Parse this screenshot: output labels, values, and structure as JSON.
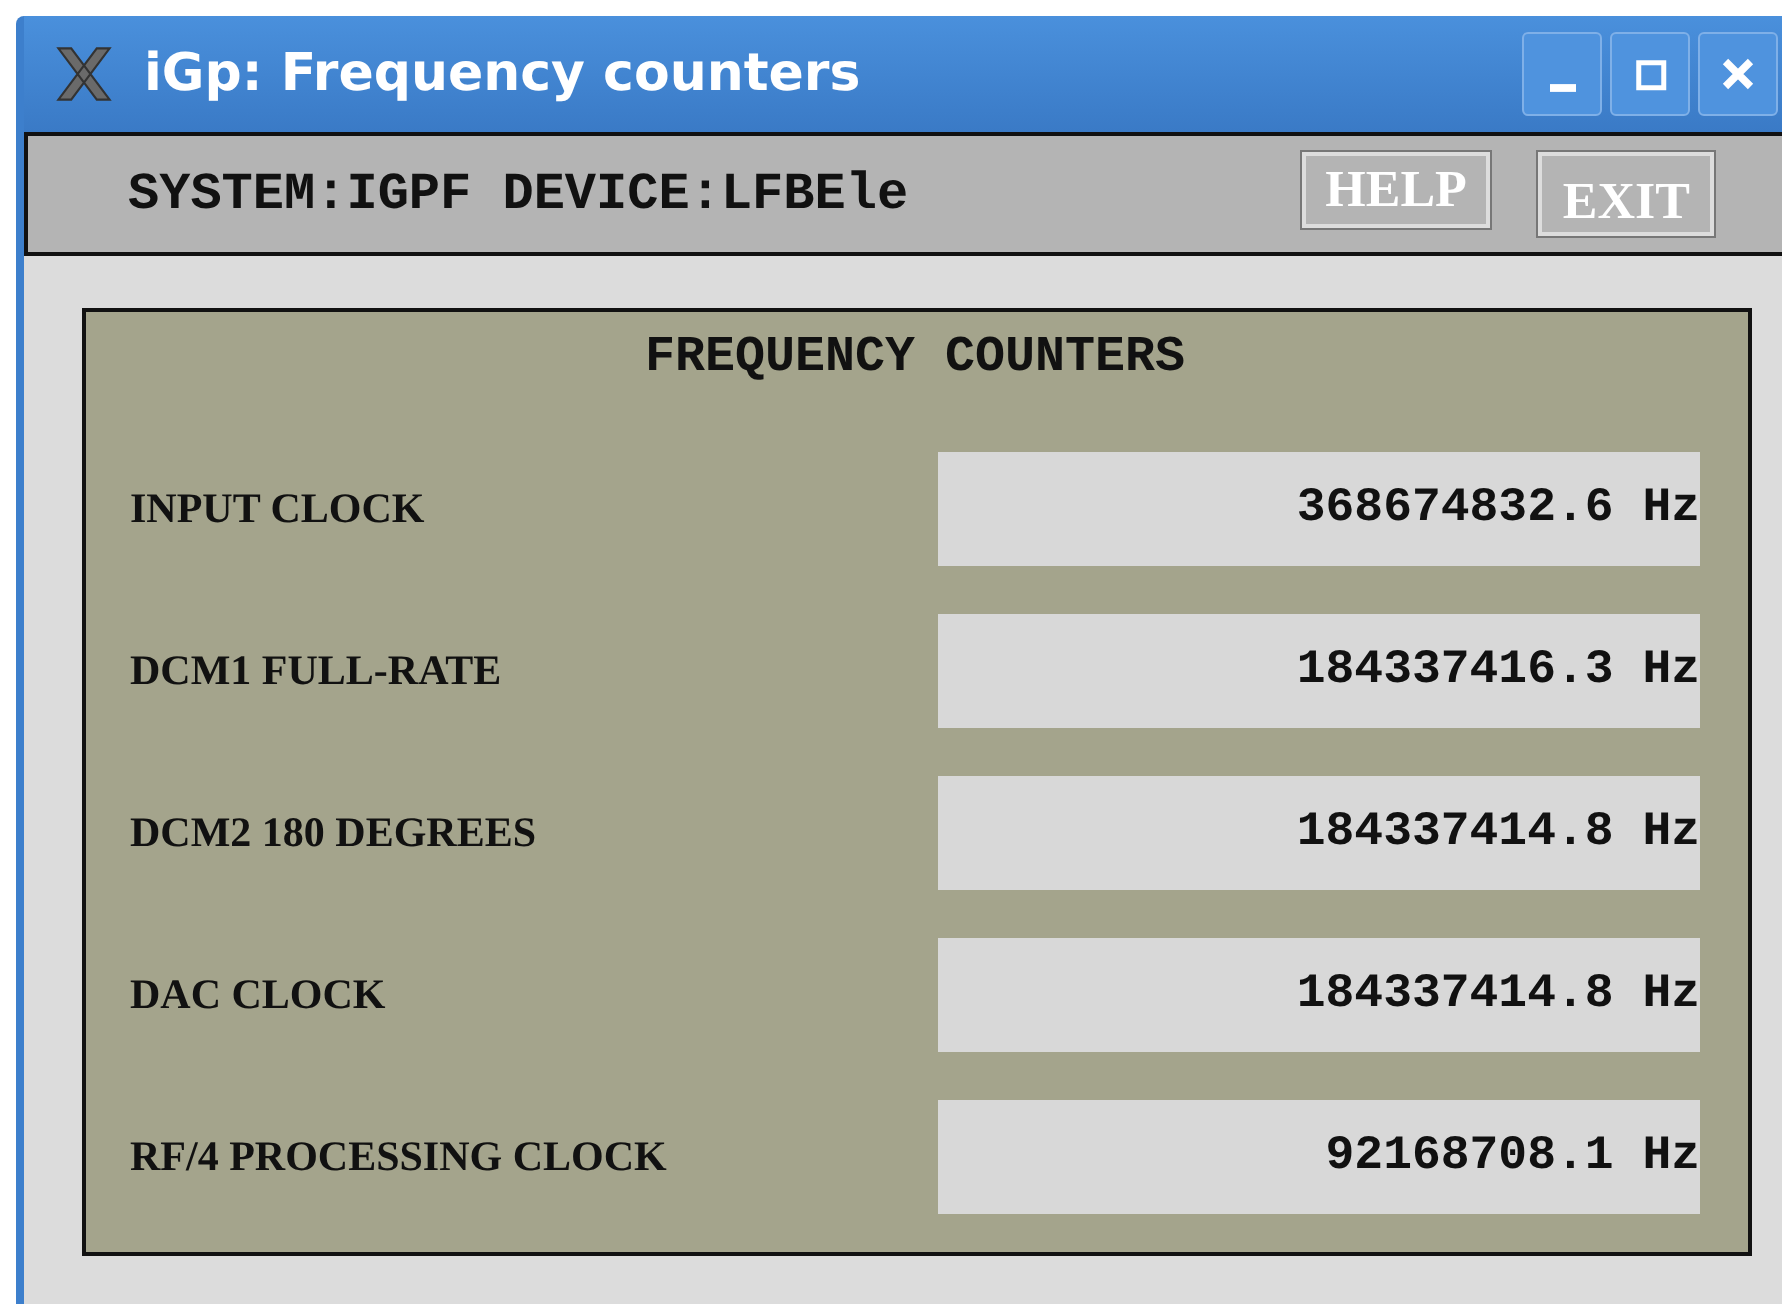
{
  "window": {
    "title": "iGp: Frequency counters",
    "controls": [
      {
        "kind": "minimize"
      },
      {
        "kind": "maximize"
      },
      {
        "kind": "close"
      }
    ]
  },
  "toolbar": {
    "device_label": "SYSTEM:IGPF DEVICE:LFBEle",
    "buttons": [
      "HELP",
      "EXIT"
    ]
  },
  "panel": {
    "title": "FREQUENCY COUNTERS",
    "rows": [
      {
        "label": "INPUT CLOCK",
        "value": "368674832.6 Hz"
      },
      {
        "label": "DCM1 FULL-RATE",
        "value": "184337416.3 Hz"
      },
      {
        "label": "DCM2 180 DEGREES",
        "value": "184337414.8 Hz"
      },
      {
        "label": "DAC CLOCK",
        "value": "184337414.8 Hz"
      },
      {
        "label": "RF/4 PROCESSING CLOCK",
        "value": "92168708.1 Hz"
      }
    ]
  }
}
